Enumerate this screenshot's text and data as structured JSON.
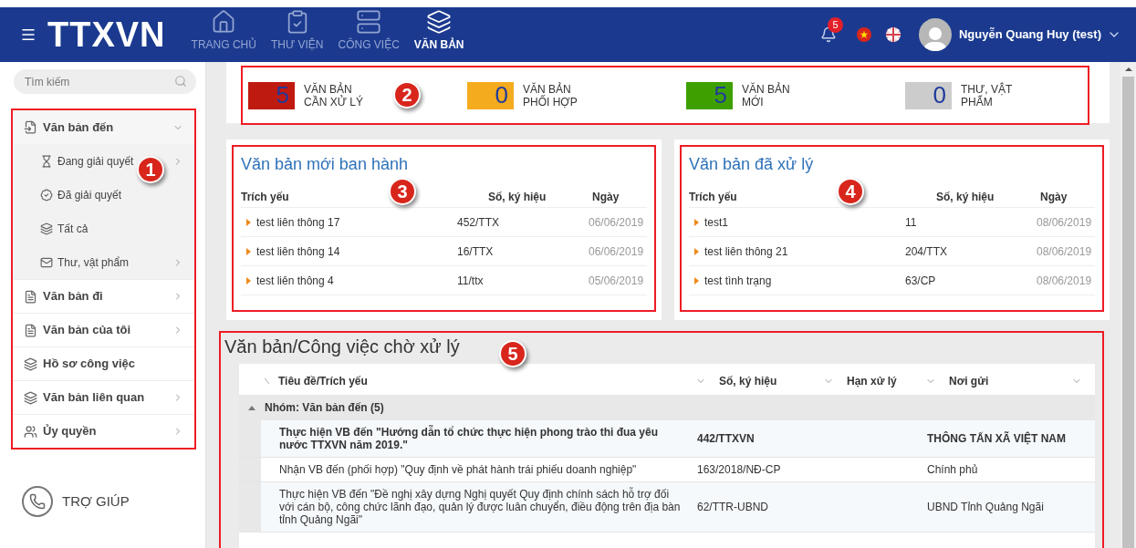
{
  "header": {
    "logo": "TTXVN",
    "nav": [
      {
        "label": "TRANG CHỦ",
        "selected": false
      },
      {
        "label": "THƯ VIỆN",
        "selected": false
      },
      {
        "label": "CÔNG VIỆC",
        "selected": false
      },
      {
        "label": "VĂN BẢN",
        "selected": true
      }
    ],
    "notification_count": "5",
    "user_name": "Nguyễn Quang Huy (test)"
  },
  "sidebar": {
    "search": {
      "placeholder": "Tìm kiếm"
    },
    "callout": "1",
    "menu": [
      {
        "label": "Văn bản đến",
        "expandable": true,
        "expanded": true,
        "children": [
          {
            "label": "Đang giải quyết",
            "expandable": true
          },
          {
            "label": "Đã giải quyết",
            "expandable": false
          },
          {
            "label": "Tất cả",
            "expandable": false
          },
          {
            "label": "Thư, vật phẩm",
            "expandable": true
          }
        ]
      },
      {
        "label": "Văn bản đi",
        "expandable": true,
        "expanded": false
      },
      {
        "label": "Văn bản của tôi",
        "expandable": true,
        "expanded": false
      },
      {
        "label": "Hồ sơ công việc",
        "expandable": false
      },
      {
        "label": "Văn bản liên quan",
        "expandable": true,
        "expanded": false
      },
      {
        "label": "Ủy quyền",
        "expandable": true,
        "expanded": false
      }
    ],
    "help": "TRỢ GIÚP"
  },
  "summary": {
    "callout": "2",
    "tiles": [
      {
        "count": "5",
        "label_lines": [
          "VĂN BẢN",
          "CẦN XỬ LÝ"
        ],
        "color": "#bf1a10"
      },
      {
        "count": "0",
        "label_lines": [
          "VĂN BẢN",
          "PHỐI HỢP"
        ],
        "color": "#f5ab1e"
      },
      {
        "count": "5",
        "label_lines": [
          "VĂN BẢN",
          "MỚI"
        ],
        "color": "#3da000"
      },
      {
        "count": "0",
        "label_lines": [
          "THƯ, VẬT",
          "PHẨM"
        ],
        "color": "#cccccc"
      }
    ]
  },
  "cards": [
    {
      "title": "Văn bản mới ban hành",
      "callout": "3",
      "columns": [
        "Trích yếu",
        "Số, ký hiệu",
        "Ngày"
      ],
      "rows": [
        [
          "test liên thông 17",
          "452/TTX",
          "06/06/2019"
        ],
        [
          "test liên thông 14",
          "16/TTX",
          "06/06/2019"
        ],
        [
          "test liên thông 4",
          "11/ttx",
          "05/06/2019"
        ]
      ]
    },
    {
      "title": "Văn bản đã xử lý",
      "callout": "4",
      "columns": [
        "Trích yếu",
        "Số, ký hiệu",
        "Ngày"
      ],
      "rows": [
        [
          "test1",
          "11",
          "08/06/2019"
        ],
        [
          "test liên thông 21",
          "204/TTX",
          "08/06/2019"
        ],
        [
          "test tình trạng",
          "63/CP",
          "08/06/2019"
        ]
      ]
    }
  ],
  "pending": {
    "title": "Văn bản/Công việc chờ xử lý",
    "callout": "5",
    "columns": [
      "Tiêu đề/Trích yếu",
      "Số, ký hiệu",
      "Hạn xử lý",
      "Nơi gửi"
    ],
    "group": {
      "label": "Nhóm: Văn bản đến (5)",
      "expanded": true
    },
    "rows": [
      {
        "title": "Thực hiện VB đến \"Hướng dẫn tổ chức thực hiện phong trào thi đua yêu nước TTXVN năm 2019.\"",
        "number": "442/TTXVN",
        "sender": "THÔNG TẤN XÃ VIỆT NAM",
        "unread": true
      },
      {
        "title": "Nhận VB đến (phối hợp) \"Quy định về phát hành trái phiếu doanh nghiệp\"",
        "number": "163/2018/NĐ-CP",
        "sender": "Chính phủ",
        "unread": false
      },
      {
        "title": "Thực hiện VB đến \"Đề nghị xây dựng Nghị quyết Quy định chính sách hỗ trợ đối với cán bộ, công chức lãnh đạo, quản lý được luân chuyển, điều động trên địa bàn tỉnh Quảng Ngãi\"",
        "number": "62/TTR-UBND",
        "sender": "UBND Tỉnh Quảng Ngãi",
        "unread": false
      }
    ]
  }
}
